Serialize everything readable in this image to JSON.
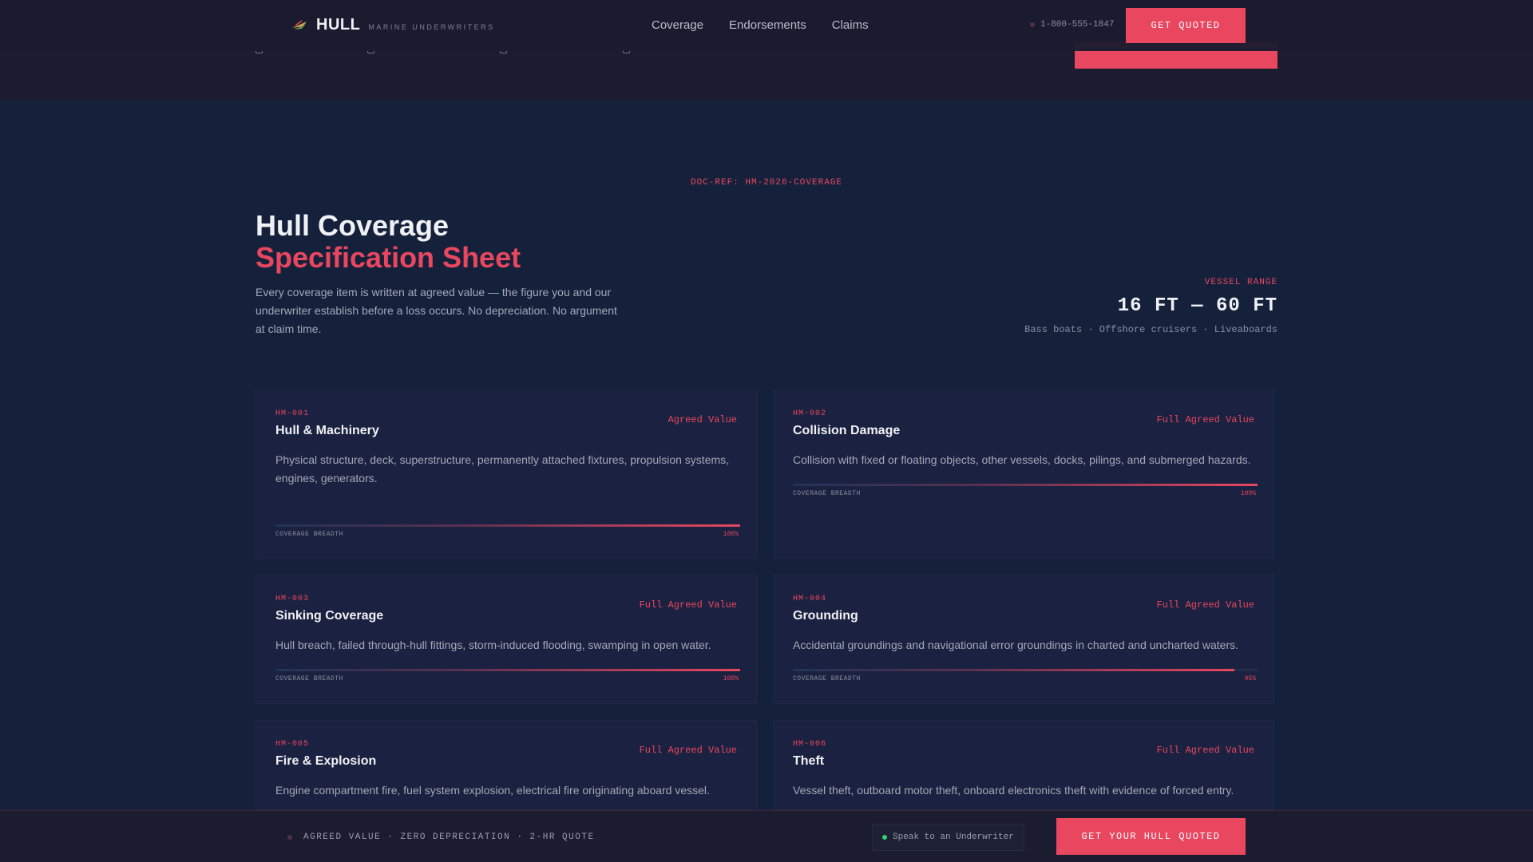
{
  "header": {
    "logo_text": "HULL",
    "logo_sub": "MARINE UNDERWRITERS",
    "nav": [
      "Coverage",
      "Endorsements",
      "Claims"
    ],
    "phone": "1-800-555-1847",
    "cta": "GET QUOTED"
  },
  "intro": {
    "doc_ref": "DOC-REF: HM-2026-COVERAGE",
    "title_line1": "Hull Coverage",
    "title_line2": "Specification Sheet",
    "description": "Every coverage item is written at agreed value — the figure you and our underwriter establish before a loss occurs. No depreciation. No argument at claim time.",
    "range_label": "VESSEL RANGE",
    "range_value": "16 FT — 60 FT",
    "range_sub": "Bass boats · Offshore cruisers · Liveaboards"
  },
  "cards": [
    {
      "code": "HM-001",
      "name": "Hull & Machinery",
      "tag": "Agreed Value",
      "description": "Physical structure, deck, superstructure, permanently attached fixtures, propulsion systems, engines, generators.",
      "bar_label": "COVERAGE BREADTH",
      "percent_text": "100%",
      "percent": 100
    },
    {
      "code": "HM-002",
      "name": "Collision Damage",
      "tag": "Full Agreed Value",
      "description": "Collision with fixed or floating objects, other vessels, docks, pilings, and submerged hazards.",
      "bar_label": "COVERAGE BREADTH",
      "percent_text": "100%",
      "percent": 100
    },
    {
      "code": "HM-003",
      "name": "Sinking Coverage",
      "tag": "Full Agreed Value",
      "description": "Hull breach, failed through-hull fittings, storm-induced flooding, swamping in open water.",
      "bar_label": "COVERAGE BREADTH",
      "percent_text": "100%",
      "percent": 100
    },
    {
      "code": "HM-004",
      "name": "Grounding",
      "tag": "Full Agreed Value",
      "description": "Accidental groundings and navigational error groundings in charted and uncharted waters.",
      "bar_label": "COVERAGE BREADTH",
      "percent_text": "95%",
      "percent": 95
    },
    {
      "code": "HM-005",
      "name": "Fire & Explosion",
      "tag": "Full Agreed Value",
      "description": "Engine compartment fire, fuel system explosion, electrical fire originating aboard vessel."
    },
    {
      "code": "HM-006",
      "name": "Theft",
      "tag": "Full Agreed Value",
      "description": "Vessel theft, outboard motor theft, onboard electronics theft with evidence of forced entry."
    }
  ],
  "bottom": {
    "text": "AGREED VALUE · ZERO DEPRECIATION · 2-HR QUOTE",
    "speak": "Speak to an Underwriter",
    "cta": "GET YOUR HULL QUOTED"
  },
  "colors": {
    "accent": "#e8475f",
    "background": "#15213b",
    "card": "#1b2140",
    "header": "#1b1c30",
    "online": "#3ccf71"
  },
  "icons": [
    "hull-logo-icon",
    "phone-dot-icon",
    "status-dot-icon",
    "online-dot-icon"
  ]
}
